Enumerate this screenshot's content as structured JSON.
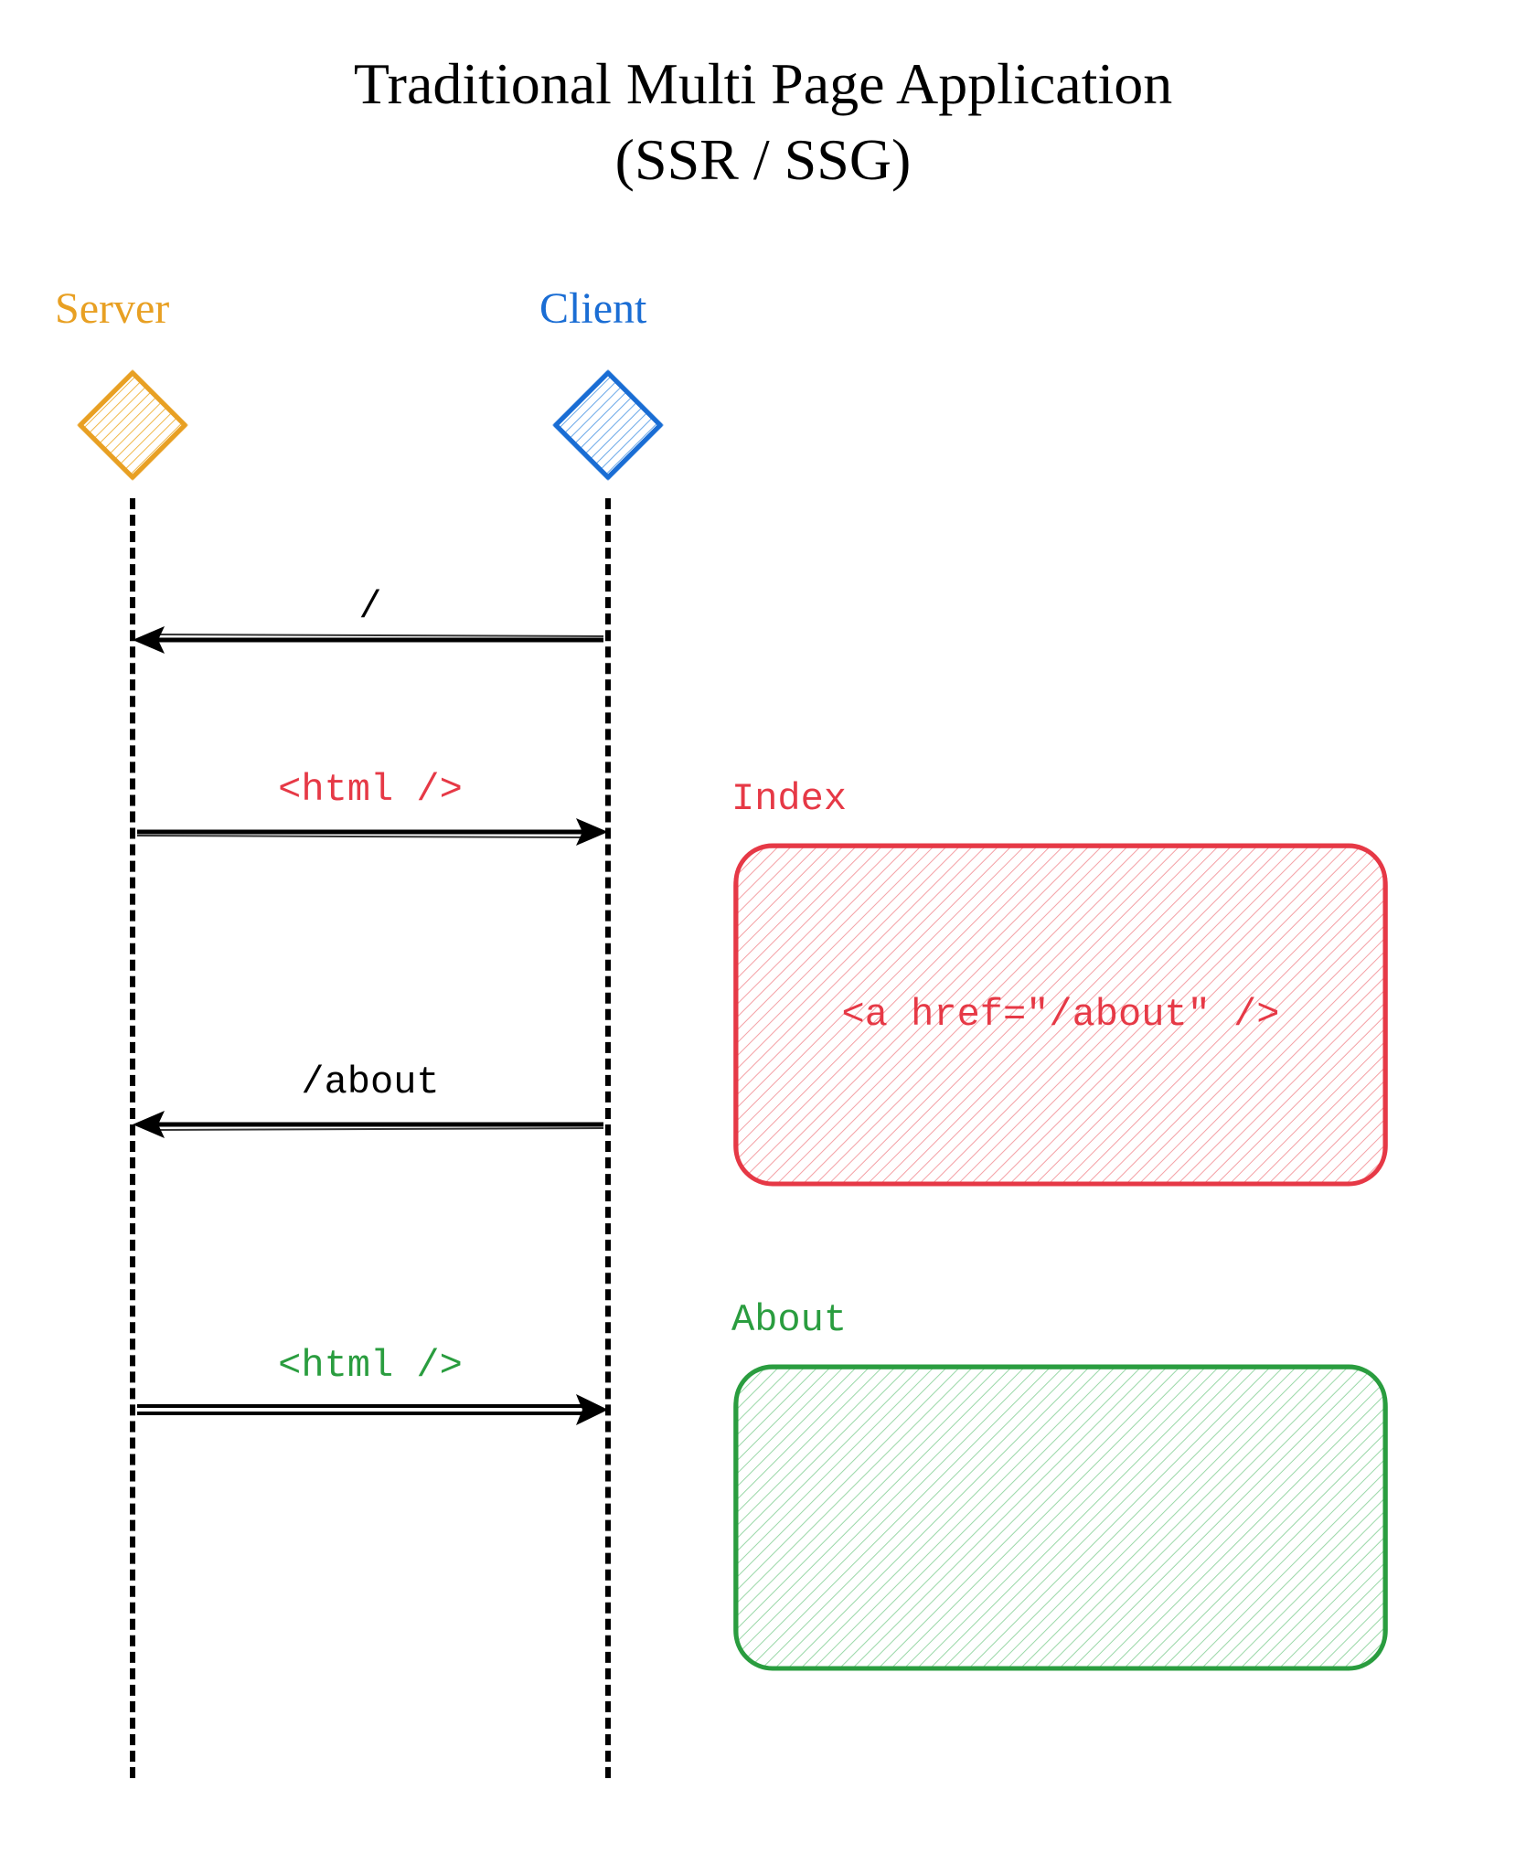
{
  "title_line1": "Traditional Multi Page Application",
  "title_line2": "(SSR / SSG)",
  "actors": {
    "server": "Server",
    "client": "Client"
  },
  "colors": {
    "server": "#e8a023",
    "client": "#1a6dd4",
    "index": "#e63946",
    "about": "#2a9d3f",
    "black": "#000000"
  },
  "messages": {
    "req1": "/",
    "resp1": "<html />",
    "req2": "/about",
    "resp2": "<html />"
  },
  "pages": {
    "index": {
      "label": "Index",
      "content": "<a href=\"/about\" />"
    },
    "about": {
      "label": "About",
      "content": ""
    }
  }
}
